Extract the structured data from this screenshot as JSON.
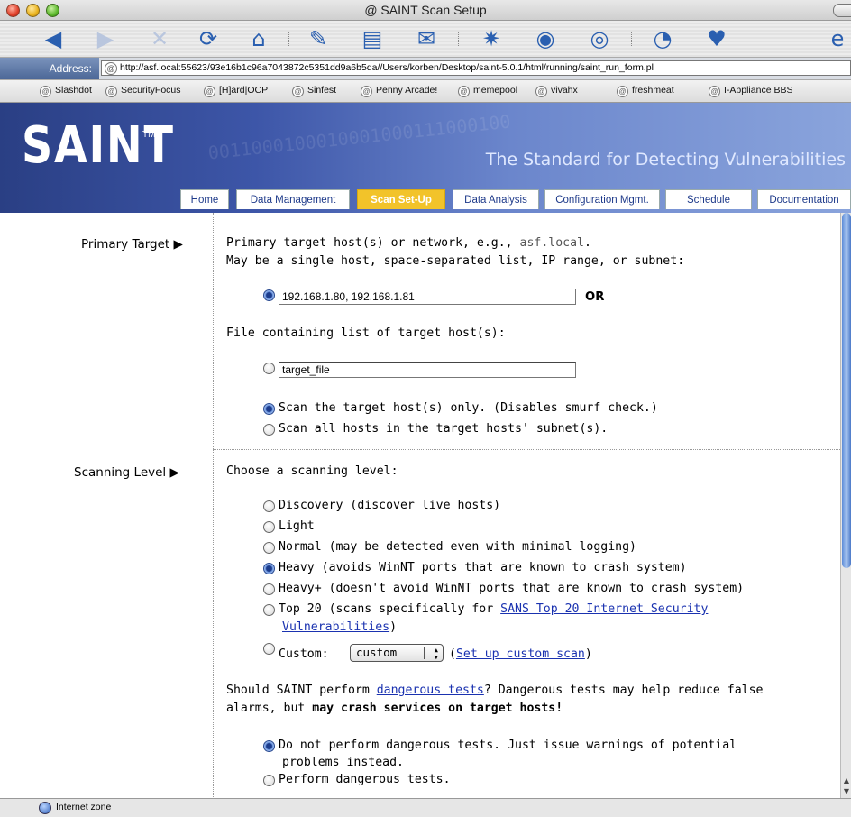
{
  "window": {
    "title": "SAINT Scan Setup",
    "title_icon": "at-sign-icon"
  },
  "toolbar": {
    "buttons": [
      {
        "name": "back",
        "icon": "back-arrow-icon"
      },
      {
        "name": "forward",
        "icon": "forward-arrow-icon"
      },
      {
        "name": "stop",
        "icon": "stop-x-icon"
      },
      {
        "name": "refresh",
        "icon": "refresh-icon"
      },
      {
        "name": "home",
        "icon": "home-icon"
      },
      {
        "name": "autofill",
        "icon": "autofill-icon"
      },
      {
        "name": "print",
        "icon": "print-icon"
      },
      {
        "name": "mail",
        "icon": "mail-icon"
      },
      {
        "name": "favorites",
        "icon": "favorites-icon"
      },
      {
        "name": "history",
        "icon": "history-icon"
      },
      {
        "name": "search",
        "icon": "search-icon"
      },
      {
        "name": "scrapbook",
        "icon": "scrapbook-icon"
      },
      {
        "name": "page-holder",
        "icon": "page-holder-icon"
      },
      {
        "name": "explorer",
        "icon": "explorer-e-icon"
      }
    ]
  },
  "address": {
    "label": "Address:",
    "url": "http://asf.local:55623/93e16b1c96a7043872c5351dd9a6b5da//Users/korben/Desktop/saint-5.0.1/html/running/saint_run_form.pl"
  },
  "bookmarks": [
    "Slashdot",
    "SecurityFocus",
    "[H]ard|OCP",
    "Sinfest",
    "Penny Arcade!",
    "memepool",
    "vivahx",
    "freshmeat",
    "I-Appliance BBS"
  ],
  "banner": {
    "logo": "SAINT",
    "trademark": "TM",
    "tagline": "The Standard for Detecting Vulnerabilities",
    "tabs": [
      "Home",
      "Data Management",
      "Scan Set-Up",
      "Data Analysis",
      "Configuration Mgmt.",
      "Schedule",
      "Documentation"
    ],
    "active_tab": "Scan Set-Up",
    "accent_color": "#f2c32a"
  },
  "primary": {
    "label": "Primary Target",
    "line1_prefix": "Primary target host(s) or network, e.g., ",
    "line1_example": "asf.local",
    "line1_suffix": ".",
    "line2": "May be a single host, space-separated list, IP range, or subnet:",
    "hosts_value": "192.168.1.80, 192.168.1.81",
    "or": "OR",
    "file_label": "File containing list of target host(s):",
    "file_value": "target_file",
    "scope_only": "Scan the target host(s) only. (Disables smurf check.)",
    "scope_subnet": "Scan all hosts in the target hosts' subnet(s)."
  },
  "scanning": {
    "label": "Scanning Level",
    "prompt": "Choose a scanning level:",
    "options": [
      "Discovery (discover live hosts)",
      "Light",
      "Normal (may be detected even with minimal logging)",
      "Heavy (avoids WinNT ports that are known to crash system)",
      "Heavy+ (doesn't avoid WinNT ports that are known to crash system)"
    ],
    "top20_prefix": "Top 20 (scans specifically for ",
    "top20_link1": "SANS Top 20 Internet Security",
    "top20_link2": "Vulnerabilities",
    "top20_suffix": ")",
    "custom_label": "Custom:",
    "custom_select": "custom",
    "custom_link": "Set up custom scan",
    "selected": "Heavy"
  },
  "dangerous": {
    "q_prefix": "Should SAINT perform ",
    "q_link": "dangerous tests",
    "q_suffix": "? Dangerous tests may help reduce false",
    "q_line2_prefix": "alarms, but ",
    "q_line2_bold": "may crash services on target hosts!",
    "opt_no_1": "Do not perform dangerous tests. Just issue warnings of potential",
    "opt_no_2": "problems instead.",
    "opt_yes": "Perform dangerous tests."
  },
  "status": {
    "text": "Internet zone"
  }
}
